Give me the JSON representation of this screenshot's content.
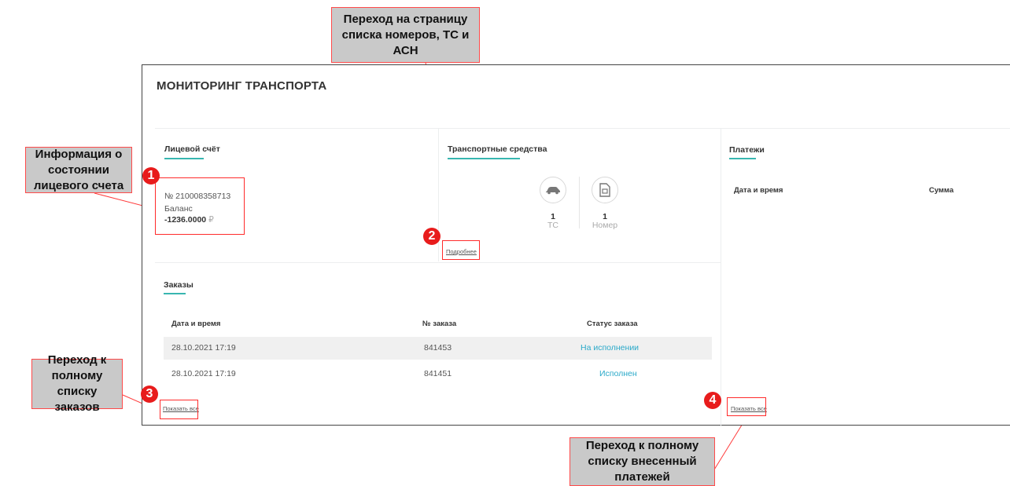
{
  "callouts": {
    "numbers_page": "Переход на страницу списка номеров, ТС и АСН",
    "account_info": "Информация о состоянии лицевого счета",
    "orders_full_list": "Переход к полному списку заказов",
    "payments_full_list": "Переход к полному списку внесенный платежей"
  },
  "markers": [
    "1",
    "2",
    "3",
    "4"
  ],
  "page": {
    "title": "МОНИТОРИНГ ТРАНСПОРТА"
  },
  "account": {
    "title": "Лицевой счёт",
    "number": "№ 210008358713",
    "balance_label": "Баланс",
    "balance_value": "-1236.0000",
    "currency": "₽"
  },
  "vehicles": {
    "title": "Транспортные средства",
    "vehicle_count": "1",
    "vehicle_label": "ТС",
    "number_count": "1",
    "number_label": "Номер",
    "details_link": "Подробнее",
    "icons": [
      "car-icon",
      "sim-card-icon"
    ]
  },
  "payments": {
    "title": "Платежи",
    "columns": [
      "Дата и время",
      "Сумма"
    ],
    "show_all": "Показать все"
  },
  "orders": {
    "title": "Заказы",
    "columns": [
      "Дата и время",
      "№ заказа",
      "Статус заказа"
    ],
    "rows": [
      {
        "datetime": "28.10.2021 17:19",
        "number": "841453",
        "status": "На исполнении"
      },
      {
        "datetime": "28.10.2021 17:19",
        "number": "841451",
        "status": "Исполнен"
      }
    ],
    "show_all": "Показать все"
  },
  "colors": {
    "accent": "#38b6b0",
    "status": "#2aa9c9",
    "marker": "#e81c1c",
    "callout_bg": "#c9c9c9"
  }
}
